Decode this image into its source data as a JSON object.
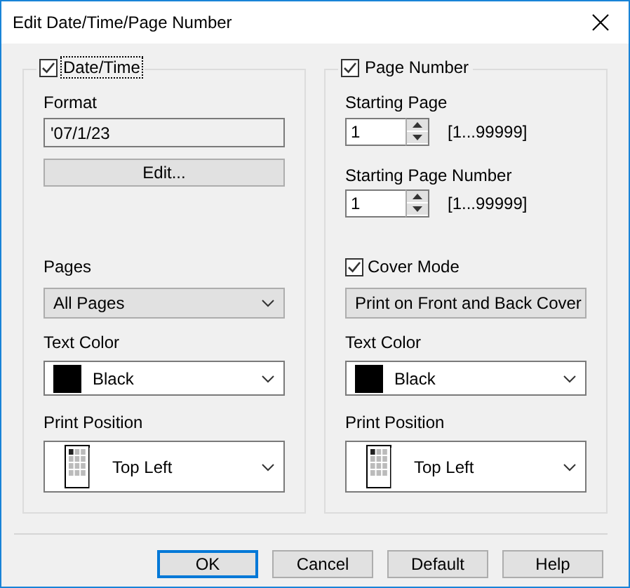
{
  "window": {
    "title": "Edit Date/Time/Page Number"
  },
  "date_time": {
    "label": "Date/Time",
    "checked": true,
    "focused": true,
    "format": {
      "label": "Format",
      "value": "'07/1/23"
    },
    "edit_button": "Edit...",
    "pages": {
      "label": "Pages",
      "value": "All Pages"
    },
    "text_color": {
      "label": "Text Color",
      "value": "Black",
      "color": "#000000"
    },
    "print_position": {
      "label": "Print Position",
      "value": "Top Left"
    }
  },
  "page_number": {
    "label": "Page Number",
    "checked": true,
    "focused": false,
    "starting_page": {
      "label": "Starting Page",
      "value": "1",
      "range": "[1...99999]"
    },
    "starting_page_number": {
      "label": "Starting Page Number",
      "value": "1",
      "range": "[1...99999]"
    },
    "cover_mode": {
      "label": "Cover Mode",
      "checked": true,
      "value": "Print on Front and Back Cover"
    },
    "text_color": {
      "label": "Text Color",
      "value": "Black",
      "color": "#000000"
    },
    "print_position": {
      "label": "Print Position",
      "value": "Top Left"
    }
  },
  "buttons": [
    {
      "label": "OK",
      "default": true
    },
    {
      "label": "Cancel",
      "default": false
    },
    {
      "label": "Default",
      "default": false
    },
    {
      "label": "Help",
      "default": false
    }
  ]
}
